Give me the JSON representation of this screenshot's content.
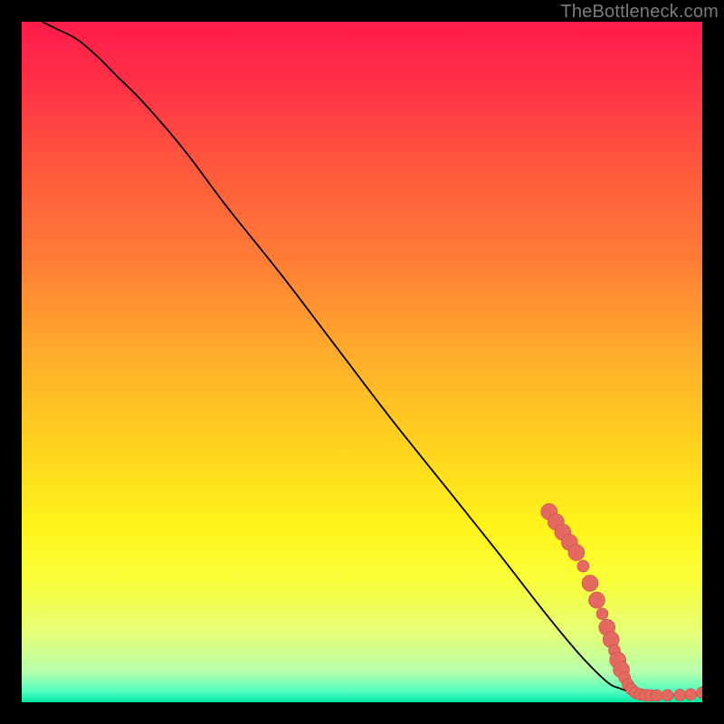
{
  "watermark": "TheBottleneck.com",
  "chart_data": {
    "type": "line",
    "title": "",
    "xlabel": "",
    "ylabel": "",
    "xlim": [
      0,
      100
    ],
    "ylim": [
      0,
      100
    ],
    "grid": false,
    "legend": false,
    "background_gradient": {
      "stops": [
        {
          "offset": 0.0,
          "color": "#ff1b4b"
        },
        {
          "offset": 0.1,
          "color": "#ff3345"
        },
        {
          "offset": 0.22,
          "color": "#ff5a3c"
        },
        {
          "offset": 0.35,
          "color": "#ff7d36"
        },
        {
          "offset": 0.5,
          "color": "#ffb02a"
        },
        {
          "offset": 0.62,
          "color": "#ffd21e"
        },
        {
          "offset": 0.74,
          "color": "#fff31a"
        },
        {
          "offset": 0.82,
          "color": "#fbff3a"
        },
        {
          "offset": 0.9,
          "color": "#e4ff77"
        },
        {
          "offset": 0.955,
          "color": "#b7ffac"
        },
        {
          "offset": 0.985,
          "color": "#4fffc0"
        },
        {
          "offset": 1.0,
          "color": "#00e8a0"
        }
      ]
    },
    "series": [
      {
        "name": "curve",
        "stroke": "#000000",
        "stroke_width": 1.8,
        "x": [
          3,
          5,
          8,
          11,
          14,
          18,
          24,
          30,
          38,
          46,
          54,
          62,
          70,
          77,
          82,
          86,
          88,
          90,
          92,
          94,
          96,
          98,
          100
        ],
        "y": [
          100,
          99,
          97.5,
          95,
          92,
          88,
          81,
          73,
          63,
          52.5,
          42,
          32,
          22,
          13,
          7,
          3,
          2,
          1.4,
          1.1,
          1,
          1,
          1.1,
          1.3
        ]
      }
    ],
    "markers": {
      "name": "dots",
      "fill": "#e46a61",
      "stroke": "#c94f46",
      "radius": 6.5,
      "cluster_radius": 9,
      "points": [
        {
          "x": 77.5,
          "y": 28,
          "big": true
        },
        {
          "x": 78.5,
          "y": 26.5,
          "big": true
        },
        {
          "x": 79.5,
          "y": 25,
          "big": true
        },
        {
          "x": 80.5,
          "y": 23.5,
          "big": true
        },
        {
          "x": 81.5,
          "y": 22,
          "big": true
        },
        {
          "x": 82.5,
          "y": 20,
          "big": false
        },
        {
          "x": 83.5,
          "y": 17.5,
          "big": true
        },
        {
          "x": 84.5,
          "y": 15,
          "big": true
        },
        {
          "x": 85.3,
          "y": 13,
          "big": false
        },
        {
          "x": 86,
          "y": 11,
          "big": true
        },
        {
          "x": 86.6,
          "y": 9.2,
          "big": true
        },
        {
          "x": 87.1,
          "y": 7.6,
          "big": false
        },
        {
          "x": 87.6,
          "y": 6.2,
          "big": true
        },
        {
          "x": 88.1,
          "y": 4.8,
          "big": true
        },
        {
          "x": 88.6,
          "y": 3.6,
          "big": false
        },
        {
          "x": 89.1,
          "y": 2.6,
          "big": false
        },
        {
          "x": 89.6,
          "y": 1.9,
          "big": false
        },
        {
          "x": 90.2,
          "y": 1.4,
          "big": false
        },
        {
          "x": 90.9,
          "y": 1.15,
          "big": false
        },
        {
          "x": 91.6,
          "y": 1.05,
          "big": false
        },
        {
          "x": 92.4,
          "y": 1.0,
          "big": false
        },
        {
          "x": 93.3,
          "y": 1.0,
          "big": false
        },
        {
          "x": 94.9,
          "y": 1.02,
          "big": false
        },
        {
          "x": 96.7,
          "y": 1.08,
          "big": false
        },
        {
          "x": 98.3,
          "y": 1.15,
          "big": false
        },
        {
          "x": 100,
          "y": 1.4,
          "big": false
        }
      ]
    }
  }
}
